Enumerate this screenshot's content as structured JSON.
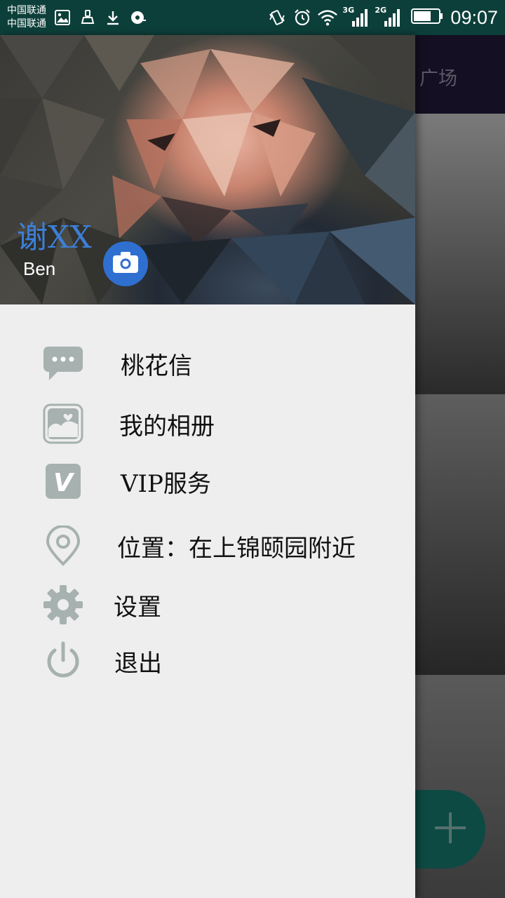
{
  "status_bar": {
    "carrier_1": "中国联通",
    "carrier_2": "中国联通",
    "network_1": "3G",
    "network_2": "2G",
    "time": "09:07",
    "icons": [
      "image-icon",
      "broom-icon",
      "download-icon",
      "music-disc-icon",
      "vibrate-icon",
      "alarm-icon",
      "wifi-icon",
      "signal-icon",
      "battery-icon"
    ]
  },
  "drawer": {
    "header": {
      "name": "谢XX",
      "alias": "Ben",
      "camera_icon": "camera-icon"
    },
    "menu": [
      {
        "label": "桃花信",
        "icon": "message-bubble-icon"
      },
      {
        "label": "我的相册",
        "icon": "photo-album-icon"
      },
      {
        "label": "VIP服务",
        "icon": "vip-icon"
      },
      {
        "label": "位置：在上锦颐园附近",
        "icon": "location-pin-icon"
      },
      {
        "label": "设置",
        "icon": "gear-icon"
      },
      {
        "label": "退出",
        "icon": "power-icon"
      }
    ]
  },
  "main": {
    "tab_label": "广场",
    "fab_icon": "plus-icon"
  },
  "colors": {
    "status_bar": "#0d3f3a",
    "drawer_bg": "#eeeeee",
    "accent_blue": "#2f6fd0",
    "icon_gray": "#a7b1b0",
    "fab": "#0d4a44"
  }
}
